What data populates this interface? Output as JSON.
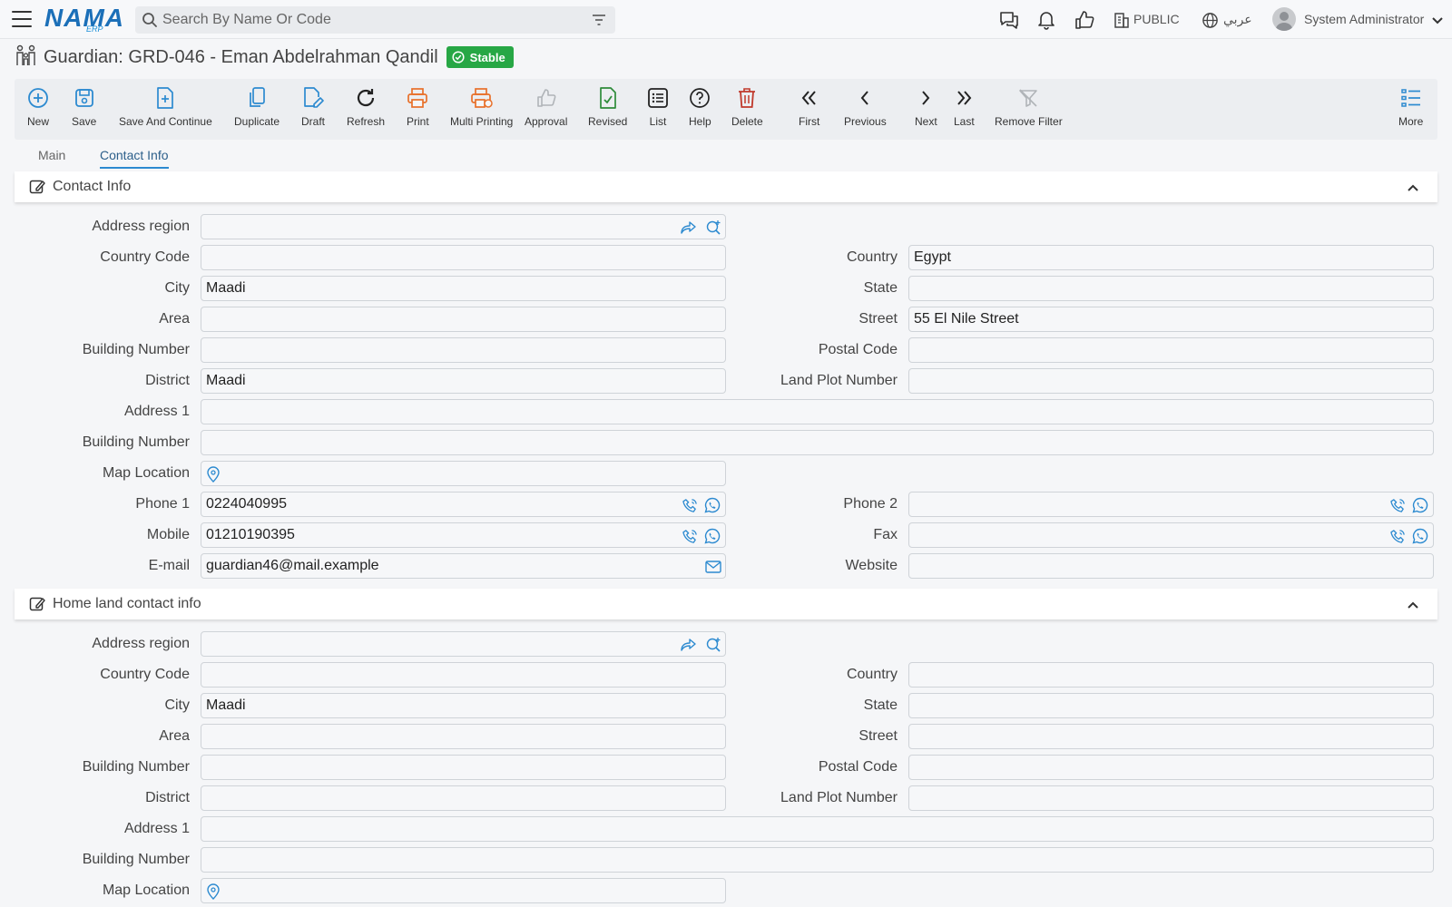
{
  "topbar": {
    "search_placeholder": "Search By Name Or Code",
    "branch": "PUBLIC",
    "language": "عربي",
    "user": "System Administrator",
    "logo_main": "NAMA",
    "logo_sub": "ERP"
  },
  "page": {
    "title": "Guardian: GRD-046 - Eman Abdelrahman Qandil",
    "status": "Stable"
  },
  "toolbar": {
    "new": "New",
    "save": "Save",
    "save_continue": "Save And Continue",
    "duplicate": "Duplicate",
    "draft": "Draft",
    "refresh": "Refresh",
    "print": "Print",
    "multi_printing": "Multi Printing",
    "approval": "Approval",
    "revised": "Revised",
    "list": "List",
    "help": "Help",
    "delete": "Delete",
    "first": "First",
    "previous": "Previous",
    "next": "Next",
    "last": "Last",
    "remove_filter": "Remove Filter",
    "more": "More"
  },
  "tabs": {
    "main": "Main",
    "contact_info": "Contact Info"
  },
  "contact": {
    "section_title": "Contact Info",
    "labels": {
      "address_region": "Address region",
      "country_code": "Country Code",
      "country": "Country",
      "city": "City",
      "state": "State",
      "area": "Area",
      "street": "Street",
      "building_number": "Building Number",
      "postal_code": "Postal Code",
      "district": "District",
      "land_plot": "Land Plot Number",
      "address1": "Address 1",
      "building_number2": "Building Number",
      "map_location": "Map Location",
      "phone1": "Phone 1",
      "phone2": "Phone 2",
      "mobile": "Mobile",
      "fax": "Fax",
      "email": "E-mail",
      "website": "Website"
    },
    "values": {
      "address_region": "",
      "country_code": "",
      "country": "Egypt",
      "city": "Maadi",
      "state": "",
      "area": "",
      "street": "55 El Nile Street",
      "building_number": "",
      "postal_code": "",
      "district": "Maadi",
      "land_plot": "",
      "address1": "",
      "building_number2": "",
      "map_location": "",
      "phone1": "0224040995",
      "phone2": "",
      "mobile": "01210190395",
      "fax": "",
      "email": "guardian46@mail.example",
      "website": ""
    }
  },
  "homeland": {
    "section_title": "Home land contact info",
    "labels": {
      "address_region": "Address region",
      "country_code": "Country Code",
      "country": "Country",
      "city": "City",
      "state": "State",
      "area": "Area",
      "street": "Street",
      "building_number": "Building Number",
      "postal_code": "Postal Code",
      "district": "District",
      "land_plot": "Land Plot Number",
      "address1": "Address 1",
      "building_number2": "Building Number",
      "map_location": "Map Location"
    },
    "values": {
      "address_region": "",
      "country_code": "",
      "country": "",
      "city": "Maadi",
      "state": "",
      "area": "",
      "street": "",
      "building_number": "",
      "postal_code": "",
      "district": "",
      "land_plot": "",
      "address1": "",
      "building_number2": "",
      "map_location": ""
    }
  },
  "colors": {
    "accent_blue": "#2c8ad0",
    "status_green": "#27a745",
    "print_orange": "#e8702a",
    "delete_red": "#c0392b",
    "revised_green": "#2e8b3a",
    "disabled_gray": "#b0b4b8"
  },
  "icons": {
    "menu": "hamburger-icon",
    "search": "search-icon",
    "filter": "filter-icon",
    "chat": "chat-icon",
    "bell": "bell-icon",
    "thumb": "thumbs-up-icon",
    "building": "building-icon",
    "globe": "globe-icon",
    "user": "user-avatar-icon"
  }
}
